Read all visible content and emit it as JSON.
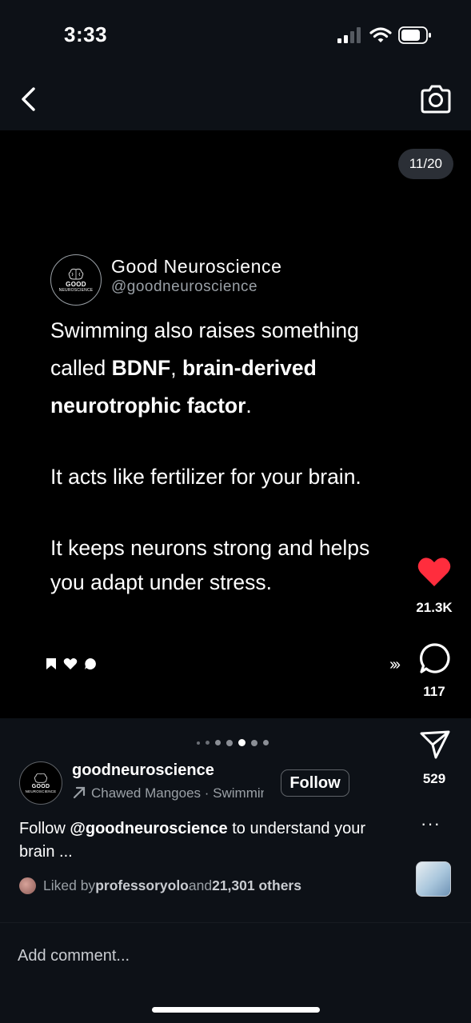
{
  "status_bar": {
    "time": "3:33"
  },
  "media": {
    "slide_counter": "11/20",
    "card": {
      "name": "Good Neuroscience",
      "handle": "@goodneuroscience",
      "avatar_text_top": "GOOD",
      "avatar_text_bottom": "NEUROSCIENCE",
      "p1_part1": "Swimming also raises something",
      "p1_part2": "called ",
      "p1_bold1": "BDNF",
      "p1_comma": ", ",
      "p1_bold2": "brain-derived",
      "p1_bold3": "neurotrophic factor",
      "p1_period": ".",
      "p2": "It acts like fertilizer for your brain.",
      "p3_line1": "It keeps neurons strong and helps",
      "p3_line2": "you adapt under stress."
    }
  },
  "actions": {
    "likes": "21.3K",
    "comments": "117",
    "shares": "529",
    "more": "···",
    "skip": "›››"
  },
  "carousel": {
    "dot_count": 7,
    "active_index": 4
  },
  "author": {
    "username": "goodneuroscience",
    "audio": "Chawed Mangoes · Swimming",
    "follow_label": "Follow"
  },
  "caption": {
    "prefix": "Follow ",
    "mention": "@goodneuroscience",
    "suffix": " to understand your brain ..."
  },
  "likes_line": {
    "prefix": "Liked by ",
    "liker": "professoryolo",
    "middle": " and ",
    "others": "21,301 others"
  },
  "comment_bar": {
    "placeholder": "Add comment..."
  },
  "colors": {
    "like_red": "#ff2d3d",
    "background": "#0d1117",
    "media_bg": "#000000"
  }
}
